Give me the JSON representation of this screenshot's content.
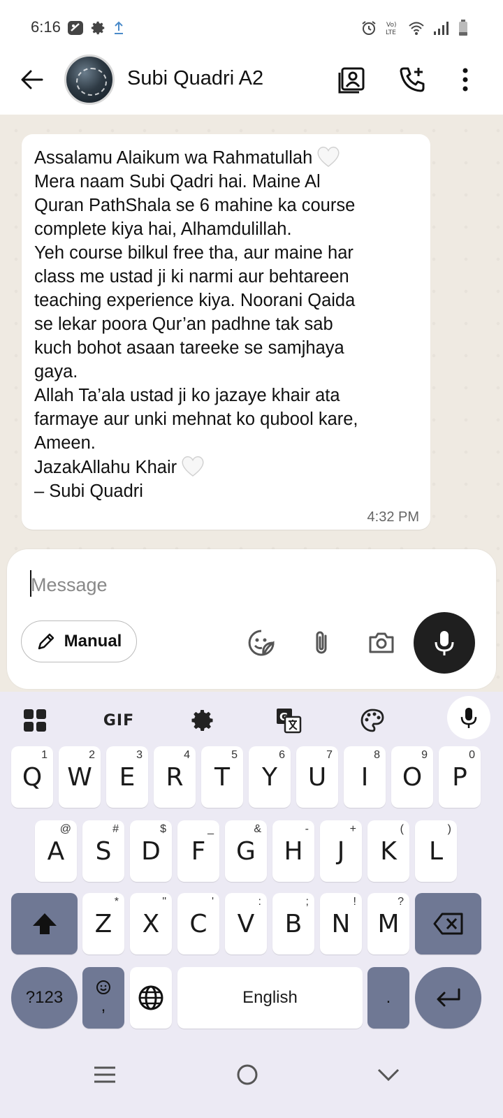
{
  "status_bar": {
    "time": "6:16"
  },
  "header": {
    "contact_name": "Subi Quadri A2"
  },
  "message": {
    "text": "Assalamu Alaikum wa Rahmatullah",
    "body": "Mera naam Subi Qadri hai. Maine Al\nQuran PathShala se 6 mahine ka course\ncomplete kiya hai, Alhamdulillah.\nYeh course bilkul free tha, aur maine har\nclass me ustad ji ki narmi aur behtareen\nteaching experience kiya. Noorani Qaida\nse lekar poora Qur’an padhne tak sab\nkuch bohot asaan tareeke se samjhaya\ngaya.\nAllah Ta’ala ustad ji ko jazaye khair ata\nfarmaye aur unki mehnat ko qubool kare,\nAmeen.",
    "closing": "JazakAllahu Khair",
    "signature": "– Subi Quadri",
    "time": "4:32 PM"
  },
  "composer": {
    "placeholder": "Message",
    "manual_label": "Manual"
  },
  "keyboard": {
    "toolbar_gif": "GIF",
    "row1": [
      {
        "key": "Q",
        "hint": "1"
      },
      {
        "key": "W",
        "hint": "2"
      },
      {
        "key": "E",
        "hint": "3"
      },
      {
        "key": "R",
        "hint": "4"
      },
      {
        "key": "T",
        "hint": "5"
      },
      {
        "key": "Y",
        "hint": "6"
      },
      {
        "key": "U",
        "hint": "7"
      },
      {
        "key": "I",
        "hint": "8"
      },
      {
        "key": "O",
        "hint": "9"
      },
      {
        "key": "P",
        "hint": "0"
      }
    ],
    "row2": [
      {
        "key": "A",
        "hint": "@"
      },
      {
        "key": "S",
        "hint": "#"
      },
      {
        "key": "D",
        "hint": "$"
      },
      {
        "key": "F",
        "hint": "_"
      },
      {
        "key": "G",
        "hint": "&"
      },
      {
        "key": "H",
        "hint": "-"
      },
      {
        "key": "J",
        "hint": "+"
      },
      {
        "key": "K",
        "hint": "("
      },
      {
        "key": "L",
        "hint": ")"
      }
    ],
    "row3": [
      {
        "key": "Z",
        "hint": "*"
      },
      {
        "key": "X",
        "hint": "\""
      },
      {
        "key": "C",
        "hint": "'"
      },
      {
        "key": "V",
        "hint": ":"
      },
      {
        "key": "B",
        "hint": ";"
      },
      {
        "key": "N",
        "hint": "!"
      },
      {
        "key": "M",
        "hint": "?"
      }
    ],
    "symbols_label": "?123",
    "emoji_comma": ",",
    "space_label": "English",
    "period": "."
  }
}
